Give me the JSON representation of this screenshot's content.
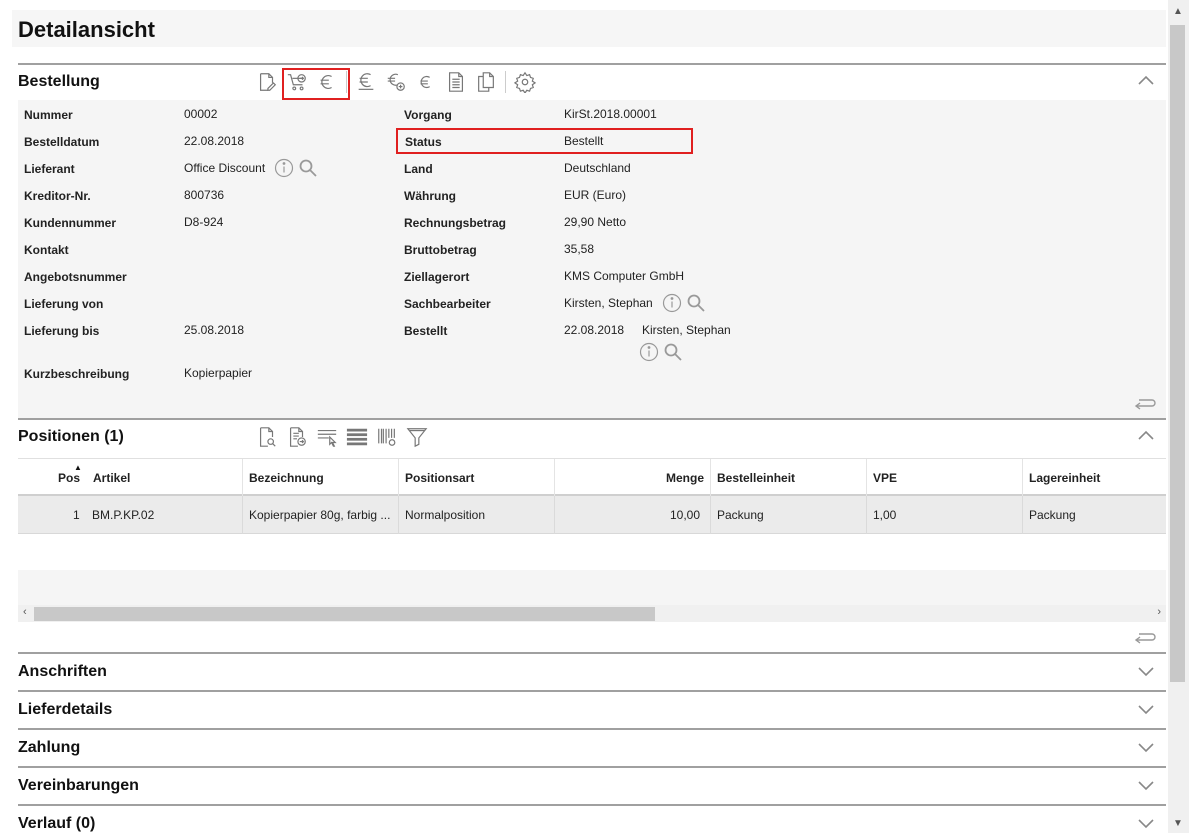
{
  "page": {
    "title": "Detailansicht"
  },
  "bestellung": {
    "section_title": "Bestellung",
    "toolbar_icons": [
      "edit-icon",
      "cart-order-icon",
      "euro-icon",
      "euro-underline-icon",
      "euro-add-icon",
      "euro-small-icon",
      "document-icon",
      "copy-icon",
      "settings-icon"
    ],
    "left_fields": [
      {
        "label": "Nummer",
        "value": "00002"
      },
      {
        "label": "Bestelldatum",
        "value": "22.08.2018"
      },
      {
        "label": "Lieferant",
        "value": "Office Discount"
      },
      {
        "label": "Kreditor-Nr.",
        "value": "800736"
      },
      {
        "label": "Kundennummer",
        "value": "D8-924"
      },
      {
        "label": "Kontakt",
        "value": ""
      },
      {
        "label": "Angebotsnummer",
        "value": ""
      },
      {
        "label": "Lieferung von",
        "value": ""
      },
      {
        "label": "Lieferung bis",
        "value": "25.08.2018"
      },
      {
        "label": "Kurzbeschreibung",
        "value": "Kopierpapier"
      }
    ],
    "right_fields": [
      {
        "label": "Vorgang",
        "value": "KirSt.2018.00001"
      },
      {
        "label": "Status",
        "value": "Bestellt"
      },
      {
        "label": "Land",
        "value": "Deutschland"
      },
      {
        "label": "Währung",
        "value": "EUR (Euro)"
      },
      {
        "label": "Rechnungsbetrag",
        "value": "29,90 Netto"
      },
      {
        "label": "Bruttobetrag",
        "value": "35,58"
      },
      {
        "label": "Ziellagerort",
        "value": "KMS Computer GmbH"
      },
      {
        "label": "Sachbearbeiter",
        "value": "Kirsten, Stephan"
      },
      {
        "label": "Bestellt",
        "value": "22.08.2018",
        "value2": "Kirsten, Stephan"
      }
    ]
  },
  "positionen": {
    "section_title": "Positionen (1)",
    "toolbar_icons": [
      "document-search-icon",
      "document-forward-icon",
      "column-select-icon",
      "rows-icon",
      "barcode-settings-icon",
      "filter-icon"
    ],
    "columns": [
      "Pos",
      "Artikel",
      "Bezeichnung",
      "Positionsart",
      "Menge",
      "Bestelleinheit",
      "VPE",
      "Lagereinheit"
    ],
    "rows": [
      {
        "pos": "1",
        "artikel": "BM.P.KP.02",
        "bezeichnung": "Kopierpapier 80g, farbig ...",
        "positionsart": "Normalposition",
        "menge": "10,00",
        "bestelleinheit": "Packung",
        "vpe": "1,00",
        "lagereinheit": "Packung"
      }
    ]
  },
  "collapsed_sections": [
    "Anschriften",
    "Lieferdetails",
    "Zahlung",
    "Vereinbarungen",
    "Verlauf (0)"
  ],
  "scrollbars": {
    "hscroll_arrows": [
      "‹",
      "›"
    ],
    "vscroll_arrows": [
      "▲",
      "▼"
    ]
  }
}
